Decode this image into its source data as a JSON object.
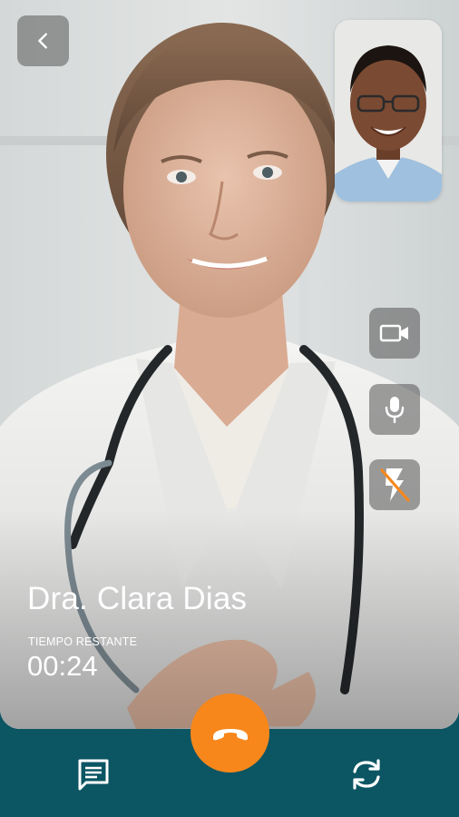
{
  "call": {
    "doctor_name": "Dra. Clara Dias",
    "time_label": "TIEMPO RESTANTE",
    "time_remaining": "00:24"
  },
  "icons": {
    "back": "chevron-left-icon",
    "video": "video-camera-icon",
    "mic": "microphone-icon",
    "flash": "flash-off-icon",
    "end_call": "phone-hangup-icon",
    "chat": "chat-icon",
    "switch_camera": "camera-switch-icon"
  },
  "colors": {
    "bottom_bar": "#0c5563",
    "end_call": "#f7871b",
    "control_bg": "rgba(85,85,85,0.55)"
  }
}
